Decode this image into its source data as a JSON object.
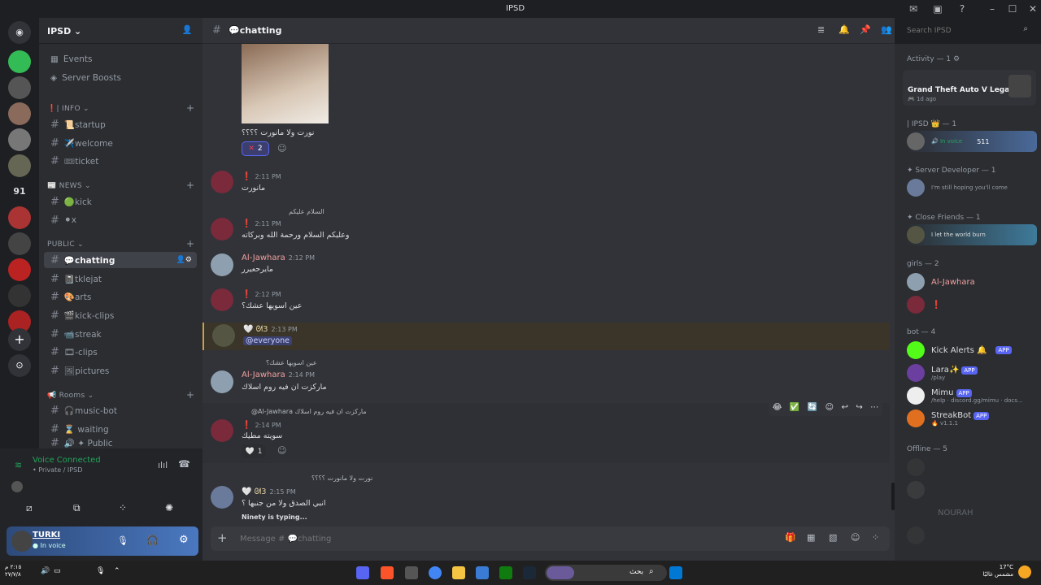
{
  "app": {
    "title": "IPSD"
  },
  "guild": {
    "name": "IPSD ⌄"
  },
  "nav": {
    "events": "Events",
    "boosts": "Server Boosts"
  },
  "categories": {
    "info": "❗| INFO ⌄",
    "news": "📰 NEWS ⌄",
    "public": "PUBLIC ⌄",
    "rooms": "📢 Rooms ⌄"
  },
  "channels": [
    {
      "label": "📜startup"
    },
    {
      "label": "✈️welcome"
    },
    {
      "label": "🎟ticket"
    },
    {
      "label": "🟢kick"
    },
    {
      "label": "⚫x"
    },
    {
      "label": "💬chatting"
    },
    {
      "label": "📓tklejat"
    },
    {
      "label": "🎨arts"
    },
    {
      "label": "🎬kick-clips"
    },
    {
      "label": "📹streak"
    },
    {
      "label": "🎞-clips"
    },
    {
      "label": "🖼pictures"
    },
    {
      "label": "🎧music-bot"
    },
    {
      "label": "⌛ waiting"
    },
    {
      "label": "🔊 ✦ Public"
    }
  ],
  "voice": {
    "status": "Voice Connected",
    "sub": "• Private / IPSD"
  },
  "user": {
    "name": "TURKI",
    "status": "● In voice"
  },
  "chat": {
    "channel": "💬chatting",
    "search": "Search IPSD",
    "message_placeholder": "Message # 💬chatting",
    "typing": "Ninety is typing..."
  },
  "messages": [
    {
      "caption": "نورت ولا مانورت ؟؟؟؟",
      "reaction": "2"
    },
    {
      "time": "2:11 PM",
      "text": "مانورت"
    },
    {
      "reply": "السلام عليكم",
      "time": "2:11 PM",
      "text": "وعليكم السلام ورحمة الله وبركاته"
    },
    {
      "name": "Al-Jawhara",
      "time": "2:12 PM",
      "text": "مايرحعيرر"
    },
    {
      "time": "2:12 PM",
      "text": "عين اسويها عشك؟"
    },
    {
      "time": "2:13 PM",
      "mention": "@everyone"
    },
    {
      "reply": "عين اسويها عشك؟",
      "name": "Al-Jawhara",
      "time": "2:14 PM",
      "text": "مارکزت ان فيه روم اسلاك"
    },
    {
      "reply": "@Al-Jawhara مارکزت ان فيه روم اسلاك",
      "time": "2:14 PM",
      "text": "سويته مطيك",
      "reaction": "1"
    },
    {
      "reply": "نورت ولا مانورت ؟؟؟؟",
      "time": "2:15 PM",
      "text": "انبي الصدق ولا من جنبها ؟"
    }
  ],
  "members": {
    "activity": "Activity — 1 ⚙",
    "game": "Grand Theft Auto V Legacy",
    "game_time": "🎮 1d ago",
    "ipsd": "| IPSD 👑 — 1",
    "in_voice": "🔊 In voice",
    "count511": "511",
    "dev": "✦ Server Developer — 1",
    "dev_status": "I'm still hoping you'll come",
    "close": "✦ Close Friends — 1",
    "close_status": "I let the world burn",
    "girls": "girls — 2",
    "jawhara": "Al-Jawhara",
    "bot": "bot — 4",
    "kick": "Kick Alerts 🔔",
    "lara": "Lara✨",
    "lara_sub": "/play",
    "mimu": "Mimu",
    "mimu_sub": "/help · discord.gg/mimu · docs...",
    "streak": "StreakBot",
    "streak_sub": "🔥 v1.1.1",
    "app": "APP",
    "offline": "Offline — 5",
    "nourah": "NOURAH"
  },
  "taskbar": {
    "search": "بحث",
    "time": "٢:١٥ م",
    "date": "٢٧/٧/٨",
    "weather": "17°C",
    "weather_sub": "مشمس غالبًا"
  }
}
